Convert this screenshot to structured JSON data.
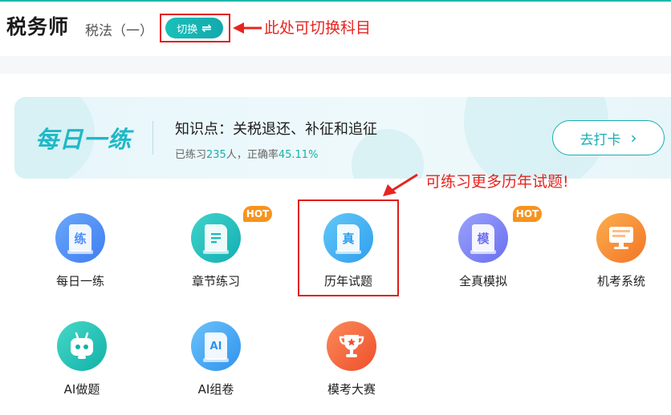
{
  "header": {
    "title": "税务师",
    "subject": "税法（一）",
    "switch_label": "切换",
    "switch_icon": "swap-arrows-icon",
    "annotation": "此处可切换科目"
  },
  "daily": {
    "logo_text": "每日一练",
    "topic": "知识点：关税退还、补征和追征",
    "stats_prefix": "已练习",
    "practiced_count": "235",
    "stats_mid": "人，正确率",
    "accuracy": "45.11%",
    "checkin_label": "去打卡",
    "checkin_icon": "chevron-right-icon"
  },
  "annotation2": "可练习更多历年试题!",
  "features": [
    {
      "label": "每日一练",
      "glyph": "练",
      "icon": "practice-doc-icon",
      "color": "#4a8cf6"
    },
    {
      "label": "章节练习",
      "glyph": "",
      "icon": "chapter-doc-icon",
      "color": "#1bbcc0",
      "badge": "HOT"
    },
    {
      "label": "历年试题",
      "glyph": "真",
      "icon": "past-exam-doc-icon",
      "color": "#3fb1ef"
    },
    {
      "label": "全真模拟",
      "glyph": "模",
      "icon": "mock-exam-doc-icon",
      "color": "#7a82f5",
      "badge": "HOT"
    },
    {
      "label": "机考系统",
      "glyph": "",
      "icon": "computer-monitor-icon",
      "color": "#f58a2a"
    },
    {
      "label": "AI做题",
      "glyph": "",
      "icon": "robot-icon",
      "color": "#1dc1b3"
    },
    {
      "label": "AI组卷",
      "glyph": "AI",
      "icon": "ai-doc-icon",
      "color": "#3fa6f2"
    },
    {
      "label": "模考大赛",
      "glyph": "",
      "icon": "trophy-icon",
      "color": "#f26a3c"
    }
  ],
  "colors": {
    "accent": "#17aeb4",
    "annotation_red": "#e8241f",
    "hot_badge": "#f7931e"
  }
}
